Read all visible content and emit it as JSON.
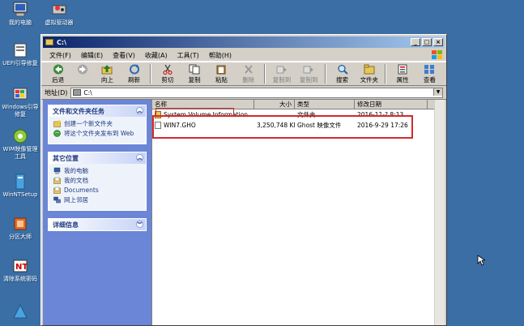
{
  "desktop": {
    "icons": [
      {
        "label": "我的电脑",
        "icon": "computer-icon"
      },
      {
        "label": "虚拟驱动器",
        "icon": "drive-icon"
      },
      {
        "label": "UEFI引导修复",
        "icon": "repair-icon"
      },
      {
        "label": "Windows引导修复",
        "icon": "boot-repair-icon"
      },
      {
        "label": "WIM映像管理工具",
        "icon": "wim-icon"
      },
      {
        "label": "WinNTSetup",
        "icon": "setup-icon"
      },
      {
        "label": "分区大师",
        "icon": "partition-icon"
      },
      {
        "label": "清除系统密码",
        "icon": "password-icon"
      }
    ]
  },
  "window": {
    "title": "C:\\",
    "menu": [
      "文件(F)",
      "编辑(E)",
      "查看(V)",
      "收藏(A)",
      "工具(T)",
      "帮助(H)"
    ],
    "toolbar": {
      "back": "后退",
      "forward": "",
      "up": "向上",
      "refresh": "刷新",
      "cut": "剪切",
      "copy": "复制",
      "paste": "粘贴",
      "delete": "删除",
      "copyto": "复制到",
      "moveto": "复制到",
      "search": "搜索",
      "folders": "文件夹",
      "properties": "属性",
      "views": "查看"
    },
    "address": {
      "label": "地址(D)",
      "value": "C:\\"
    }
  },
  "taskpane": {
    "tasks": {
      "title": "文件和文件夹任务",
      "links": [
        "创建一个新文件夹",
        "将这个文件夹发布到 Web"
      ]
    },
    "places": {
      "title": "其它位置",
      "links": [
        "我的电脑",
        "我的文档",
        "Documents",
        "网上邻居"
      ]
    },
    "details": {
      "title": "详细信息"
    }
  },
  "filelist": {
    "columns": {
      "name": "名称",
      "size": "大小",
      "type": "类型",
      "date": "修改日期"
    },
    "rows": [
      {
        "name": "System Volume Information",
        "size": "",
        "type": "文件夹",
        "date": "2016-11-? 8:13"
      },
      {
        "name": "WIN7.GHO",
        "size": "3,250,748 KB",
        "type": "Ghost 映像文件",
        "date": "2016-9-29 17:26"
      }
    ]
  },
  "colors": {
    "desktop": "#3a6ea5",
    "highlight": "#d42a2a",
    "taskpane": "#6b86d6"
  }
}
